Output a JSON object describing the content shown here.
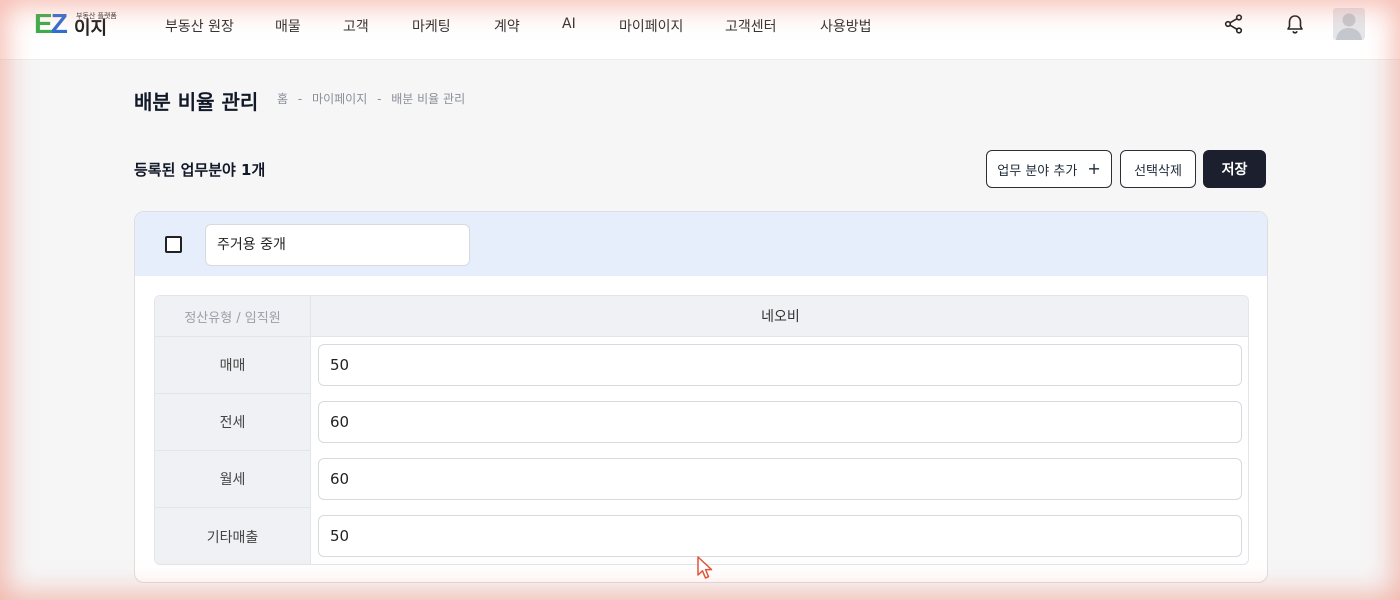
{
  "logo": {
    "ez": "EZ",
    "ezi": "이지",
    "tagline": "부동산 플랫폼"
  },
  "nav": {
    "items": [
      {
        "label": "부동산 원장"
      },
      {
        "label": "매물"
      },
      {
        "label": "고객"
      },
      {
        "label": "마케팅"
      },
      {
        "label": "계약"
      },
      {
        "label": "AI"
      },
      {
        "label": "마이페이지"
      },
      {
        "label": "고객센터"
      },
      {
        "label": "사용방법"
      }
    ],
    "icons": [
      "share-icon",
      "bell-icon",
      "avatar-icon"
    ]
  },
  "page": {
    "title": "배분 비율 관리",
    "breadcrumb": [
      "홈",
      "-",
      "마이페이지",
      "-",
      "배분 비율 관리"
    ]
  },
  "toolbar": {
    "count_label": "등록된 업무분야 1개",
    "add_label": "업무 분야 추가",
    "delete_label": "선택삭제",
    "save_label": "저장"
  },
  "card": {
    "field_name": "주거용 중개",
    "checked": false,
    "table": {
      "header_left": "정산유형 / 임직원",
      "header_right": "네오비",
      "rows": [
        {
          "label": "매매",
          "value": "50"
        },
        {
          "label": "전세",
          "value": "60"
        },
        {
          "label": "월세",
          "value": "60"
        },
        {
          "label": "기타매출",
          "value": "50"
        }
      ]
    }
  },
  "colors": {
    "accent_dark": "#1b1f2e",
    "card_head_bg": "#e7eefb",
    "logo_green": "#3aae4a",
    "logo_blue": "#2f6fd1"
  }
}
